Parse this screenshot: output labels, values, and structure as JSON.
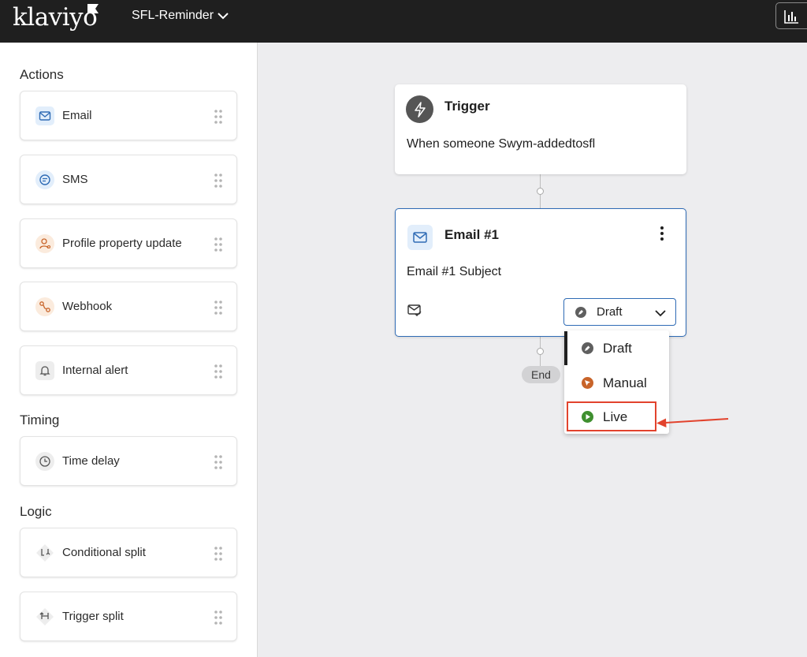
{
  "header": {
    "logo_text": "klaviyo",
    "flow_name": "SFL-Reminder"
  },
  "sidebar": {
    "sections": [
      {
        "title": "Actions",
        "items": [
          {
            "label": "Email",
            "icon": "email-icon"
          },
          {
            "label": "SMS",
            "icon": "sms-icon"
          },
          {
            "label": "Profile property update",
            "icon": "profile-update-icon"
          },
          {
            "label": "Webhook",
            "icon": "webhook-icon"
          },
          {
            "label": "Internal alert",
            "icon": "bell-icon"
          }
        ]
      },
      {
        "title": "Timing",
        "items": [
          {
            "label": "Time delay",
            "icon": "clock-icon"
          }
        ]
      },
      {
        "title": "Logic",
        "items": [
          {
            "label": "Conditional split",
            "icon": "conditional-split-icon"
          },
          {
            "label": "Trigger split",
            "icon": "trigger-split-icon"
          }
        ]
      }
    ]
  },
  "canvas": {
    "trigger": {
      "title": "Trigger",
      "description": "When someone Swym-addedtosfl"
    },
    "email": {
      "title": "Email #1",
      "subject": "Email #1 Subject",
      "status": "Draft"
    },
    "end_label": "End"
  },
  "status_dropdown": {
    "options": [
      {
        "label": "Draft",
        "color": "#5f5f5f",
        "selected": true
      },
      {
        "label": "Manual",
        "color": "#c8642a",
        "selected": false
      },
      {
        "label": "Live",
        "color": "#3f8f2f",
        "selected": false
      }
    ],
    "highlighted": "Live"
  },
  "colors": {
    "topbar": "#1f1f1f",
    "accent": "#2f6bb5",
    "annotation": "#e2432d"
  }
}
